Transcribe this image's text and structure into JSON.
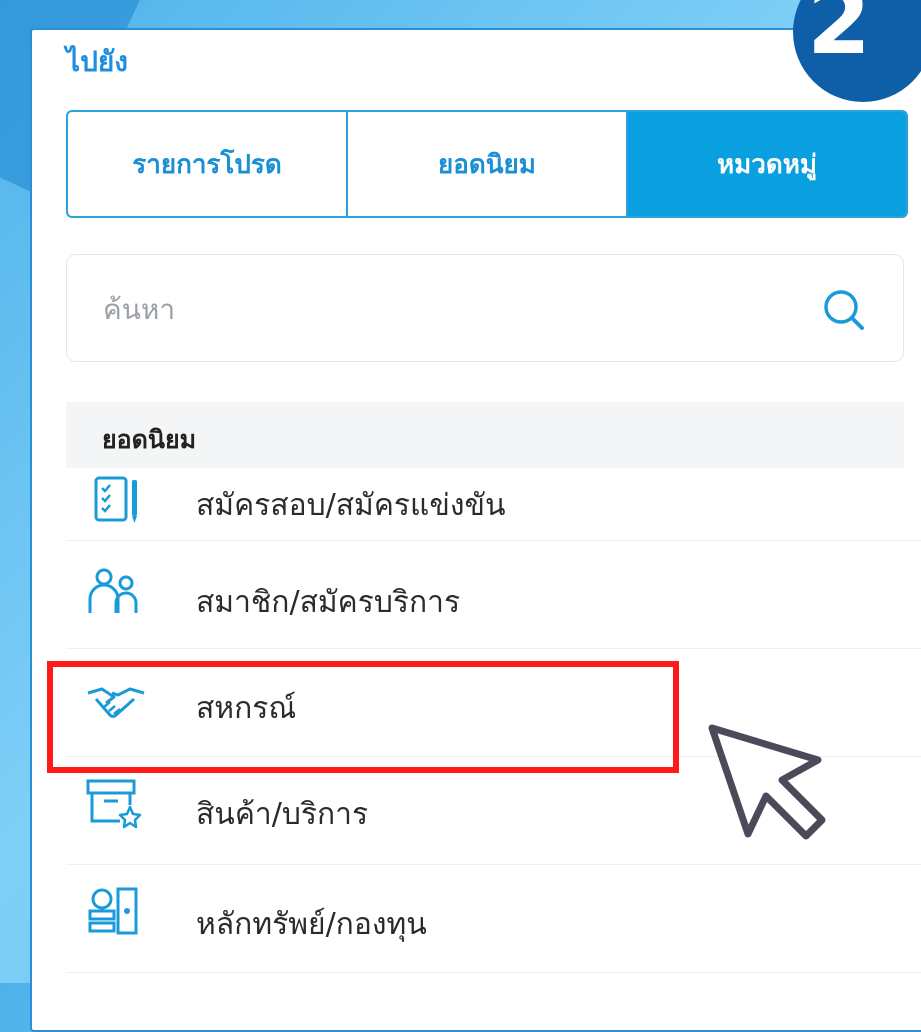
{
  "step_badge": "2",
  "goto_title": "ไปยัง",
  "tabs": [
    {
      "label": "รายการโปรด",
      "active": false
    },
    {
      "label": "ยอดนิยม",
      "active": false
    },
    {
      "label": "หมวดหมู่",
      "active": true
    }
  ],
  "search": {
    "placeholder": "ค้นหา",
    "icon": "search-icon"
  },
  "section_header": "ยอดนิยม",
  "items": [
    {
      "label": "สมัครสอบ/สมัครแข่งขัน",
      "icon": "form-checklist-icon"
    },
    {
      "label": "สมาชิก/สมัครบริการ",
      "icon": "members-icon"
    },
    {
      "label": "สหกรณ์",
      "icon": "handshake-icon",
      "highlighted": true
    },
    {
      "label": "สินค้า/บริการ",
      "icon": "product-box-icon"
    },
    {
      "label": "หลักทรัพย์/กองทุน",
      "icon": "securities-icon"
    }
  ],
  "colors": {
    "accent": "#0aa0e0",
    "highlight": "#ff1a1a",
    "badge": "#0f5fa8"
  }
}
